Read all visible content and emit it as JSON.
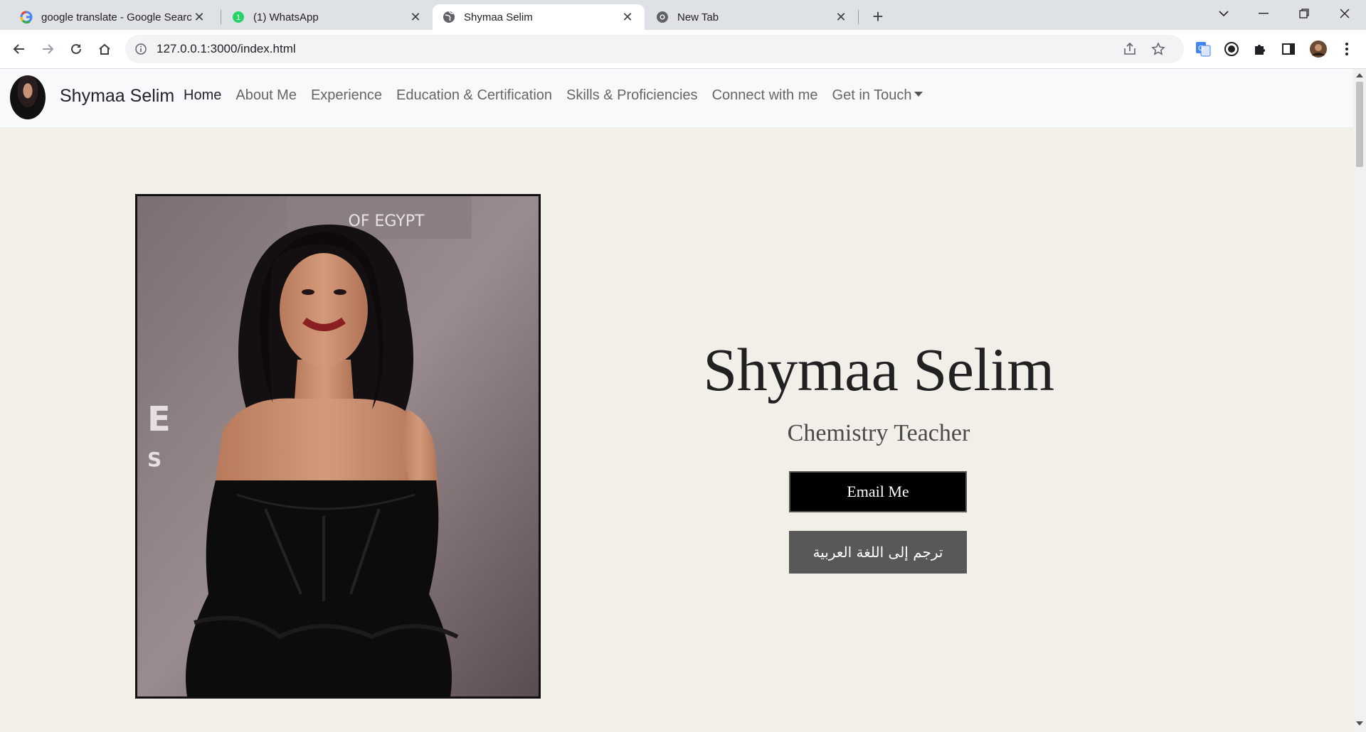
{
  "browser": {
    "tabs": [
      {
        "title": "google translate - Google Search",
        "icon": "google-icon",
        "active": false
      },
      {
        "title": "(1) WhatsApp",
        "icon": "whatsapp-icon",
        "active": false
      },
      {
        "title": "Shymaa Selim",
        "icon": "globe-icon",
        "active": true
      },
      {
        "title": "New Tab",
        "icon": "chrome-icon",
        "active": false
      }
    ],
    "address_url": "127.0.0.1:3000/index.html"
  },
  "navbar": {
    "brand": "Shymaa Selim",
    "links": [
      "Home",
      "About Me",
      "Experience",
      "Education & Certification",
      "Skills & Proficiencies",
      "Connect with me",
      "Get in Touch"
    ],
    "active_link": "Home"
  },
  "hero": {
    "name": "Shymaa Selim",
    "role": "Chemistry Teacher",
    "email_button": "Email Me",
    "translate_button": "ترجم إلى اللغة العربية"
  },
  "colors": {
    "page_bg": "#f2efe9",
    "navbar_bg": "#f8f9fa",
    "email_btn_bg": "#000000",
    "translate_btn_bg": "#585858",
    "whatsapp_green": "#25d366"
  }
}
